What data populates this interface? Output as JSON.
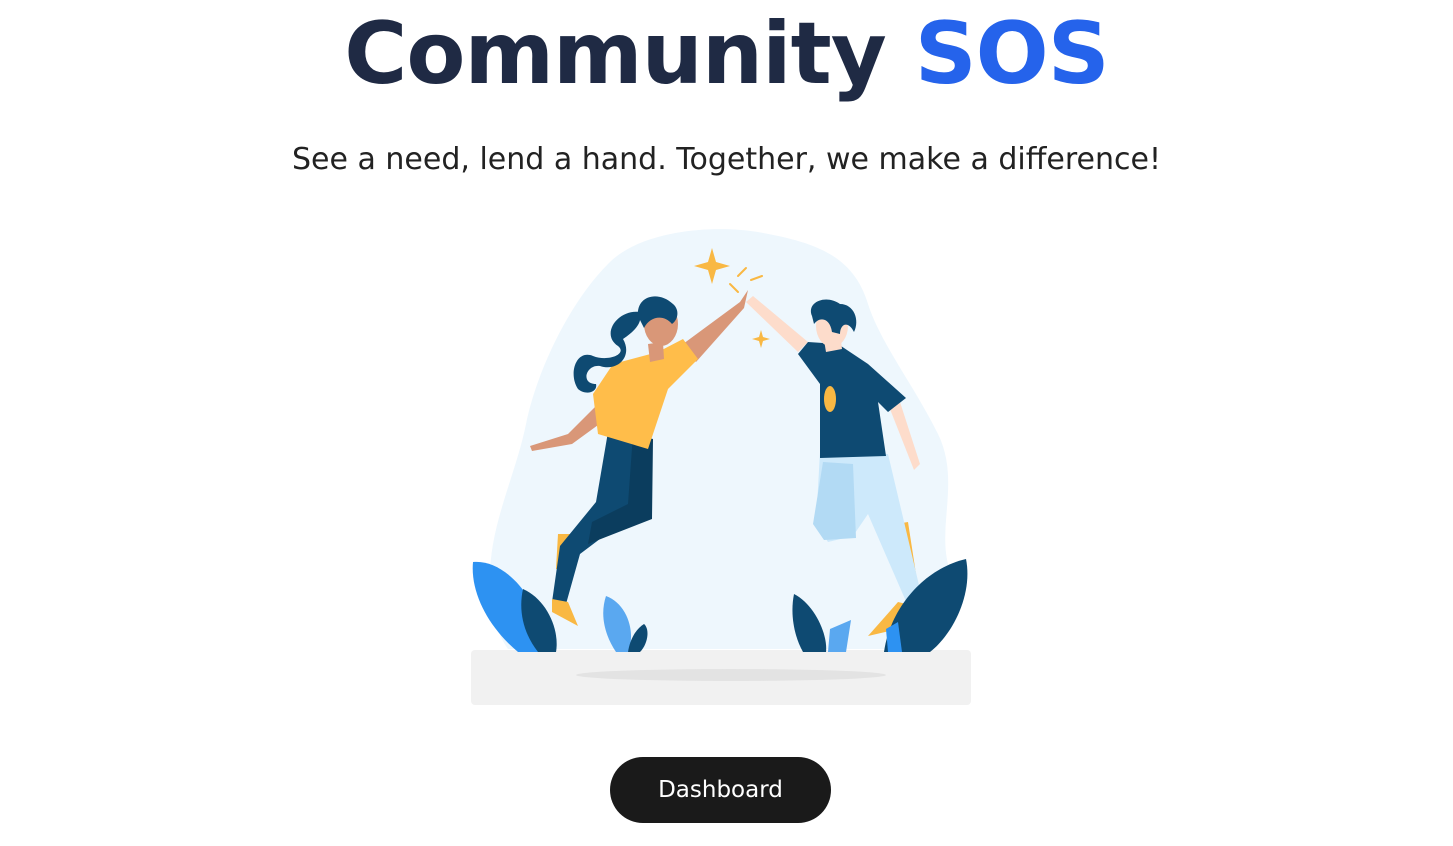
{
  "header": {
    "title_main": "Community",
    "title_accent": "SOS"
  },
  "tagline": "See a need, lend a hand. Together, we make a difference!",
  "actions": {
    "dashboard_label": "Dashboard"
  },
  "colors": {
    "title": "#1f2a44",
    "accent": "#2563eb",
    "button_bg": "#1a1a1a",
    "shirt_yellow": "#ffbd4a",
    "navy": "#0e4a72",
    "light_blue": "#cde9fb"
  },
  "illustration": {
    "subject": "two people giving a high-five",
    "icons": [
      "sparkle-icon",
      "leaf-icon"
    ]
  }
}
